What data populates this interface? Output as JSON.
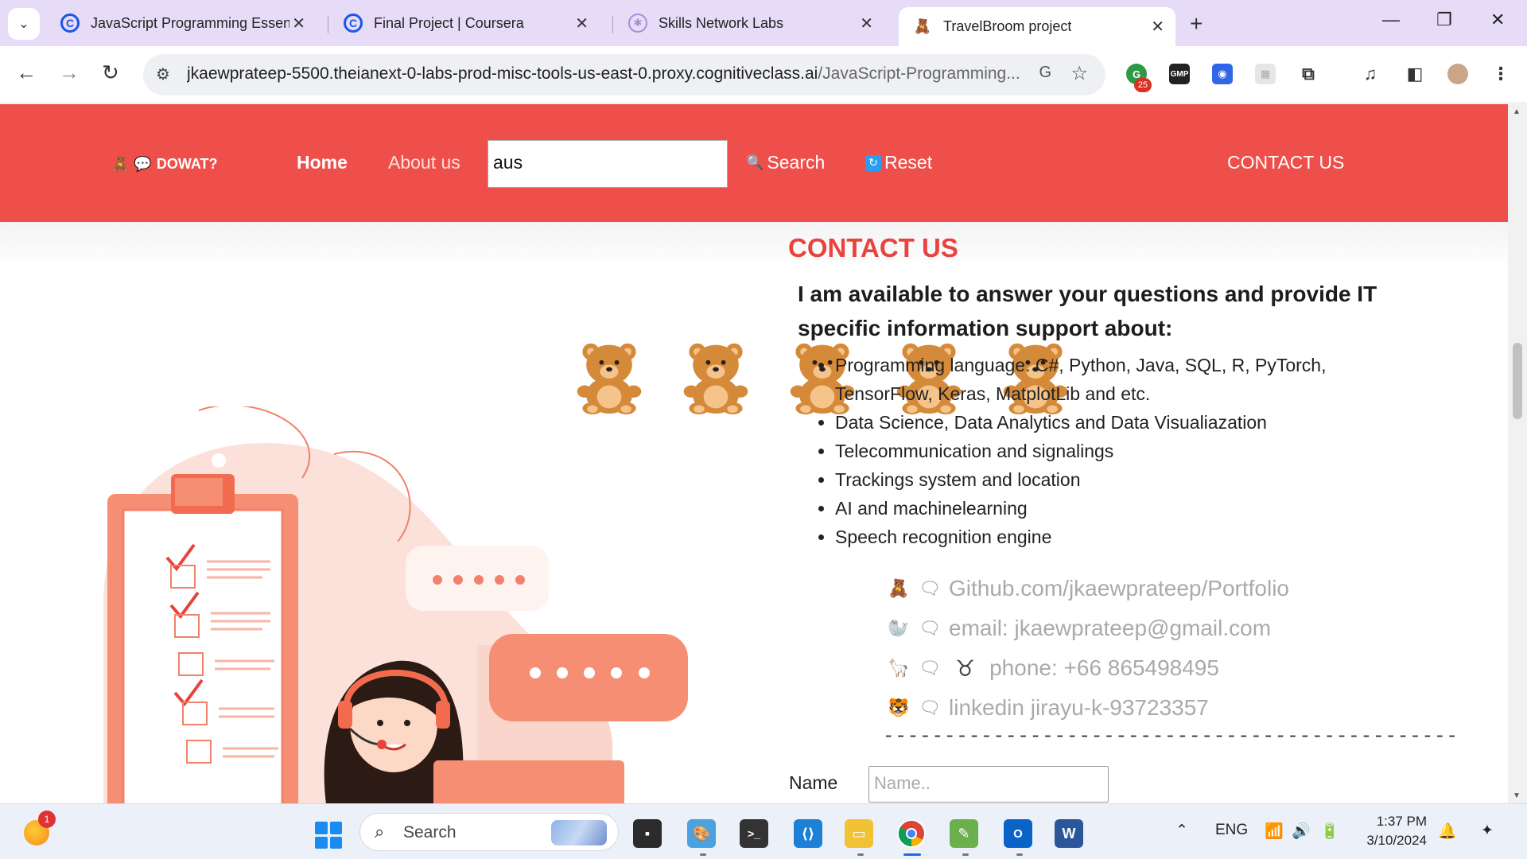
{
  "browser": {
    "tabs": [
      {
        "title": "JavaScript Programming Essenti",
        "active": false
      },
      {
        "title": "Final Project | Coursera",
        "active": false
      },
      {
        "title": "Skills Network Labs",
        "active": false
      },
      {
        "title": "TravelBroom project",
        "active": true
      }
    ],
    "url_main": "jkaewprateep-5500.theianext-0-labs-prod-misc-tools-us-east-0.proxy.cognitiveclass.ai",
    "url_rest": "/JavaScript-Programming...",
    "extension_badge": "25",
    "extension_gmp": "GMP"
  },
  "site": {
    "logo_text": "DOWAT?",
    "nav": {
      "home": "Home",
      "about": "About us",
      "search_value": "aus",
      "search": "Search",
      "reset": "Reset",
      "contact": "CONTACT US"
    },
    "contact": {
      "title": "CONTACT US",
      "intro": "I am available to answer your questions and provide IT specific information support about:",
      "skills": [
        "Programming language: C#, Python, Java, SQL, R, PyTorch, TensorFlow, Keras, MatplotLib and etc.",
        "Data Science, Data Analytics and Data Visualiazation",
        "Telecommunication and signalings",
        "Trackings system and location",
        "AI and machinelearning",
        "Speech recognition engine"
      ],
      "links": [
        {
          "icon": "bear-emoji",
          "text": "Github.com/jkaewprateep/Portfolio"
        },
        {
          "icon": "seal-emoji",
          "text": "email: jkaewprateep@gmail.com"
        },
        {
          "icon": "llama-emoji",
          "text": "phone: +66 865498495",
          "sign": "♉"
        },
        {
          "icon": "tiger-emoji",
          "text": "linkedin jirayu-k-93723357"
        }
      ],
      "divider": "-----------------------------------------------",
      "name_label": "Name",
      "name_placeholder": "Name.."
    }
  },
  "taskbar": {
    "weather_badge": "1",
    "search_label": "Search",
    "lang": "ENG",
    "time": "1:37 PM",
    "date": "3/10/2024"
  },
  "colors": {
    "header_red": "#ef4f4a",
    "title_red": "#e8433c",
    "tab_strip": "#e6dcf8"
  }
}
